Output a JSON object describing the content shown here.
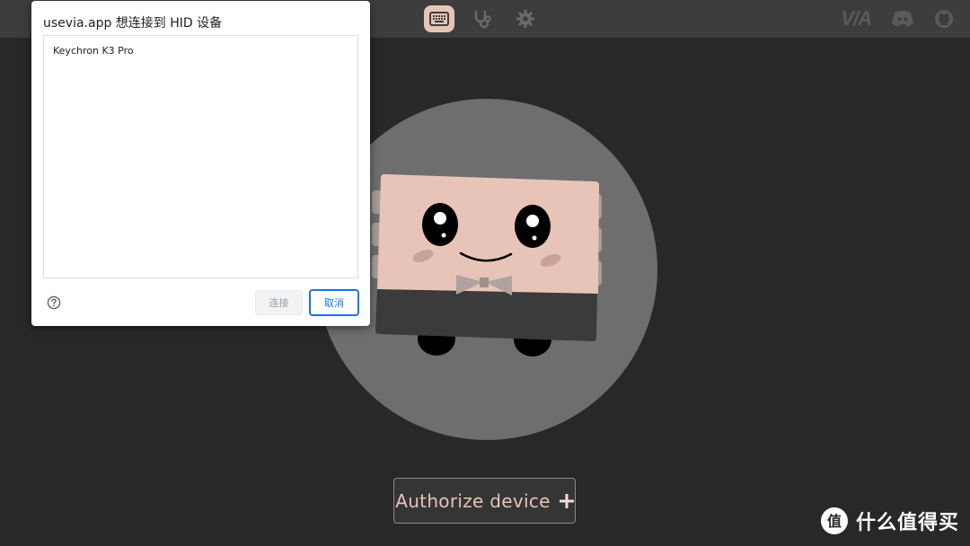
{
  "topbar": {
    "nav": [
      {
        "icon": "keyboard-icon",
        "active": true
      },
      {
        "icon": "stethoscope-icon",
        "active": false
      },
      {
        "icon": "gear-icon",
        "active": false
      }
    ],
    "logo_text": "V/A",
    "links": [
      "discord-icon",
      "github-icon"
    ]
  },
  "dialog": {
    "title": "usevia.app 想连接到 HID 设备",
    "devices": [
      "Keychron K3 Pro"
    ],
    "connect_label": "连接",
    "cancel_label": "取消"
  },
  "main": {
    "authorize_label": "Authorize device",
    "authorize_icon": "plus-icon"
  },
  "watermark": {
    "text": "什么值得买",
    "badge": "值"
  },
  "colors": {
    "background": "#282828",
    "topbar": "#3d3d3d",
    "accent": "#e8c4b8",
    "dialog_primary": "#1a73e8"
  }
}
